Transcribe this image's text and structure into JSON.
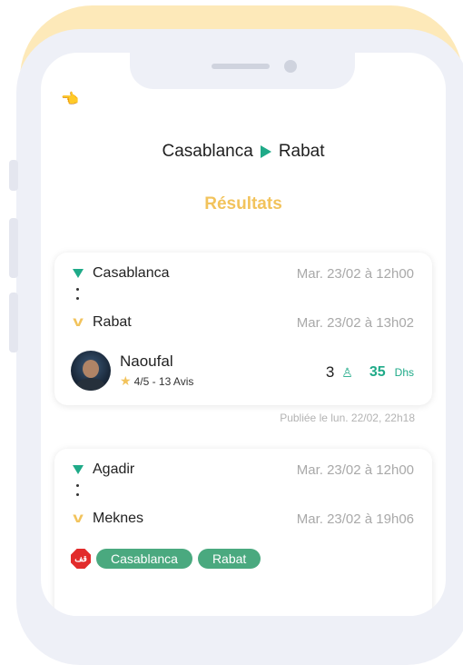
{
  "header": {
    "back_icon": "👈",
    "from": "Casablanca",
    "to": "Rabat",
    "title": "Résultats"
  },
  "results": [
    {
      "from_city": "Casablanca",
      "from_time": "Mar. 23/02 à 12h00",
      "to_city": "Rabat",
      "to_time": "Mar. 23/02 à 13h02",
      "driver_name": "Naoufal",
      "rating": "4/5 - 13 Avis",
      "seats": "3",
      "price": "35",
      "currency": "Dhs",
      "published": "Publiée le lun. 22/02, 22h18"
    },
    {
      "from_city": "Agadir",
      "from_time": "Mar. 23/02 à 12h00",
      "to_city": "Meknes",
      "to_time": "Mar. 23/02 à 19h06",
      "stop_icon_text": "قف",
      "stops": [
        "Casablanca",
        "Rabat"
      ]
    }
  ],
  "colors": {
    "accent": "#1faa88",
    "title": "#f2c35c",
    "chip": "#4aa97f",
    "stop": "#e22b2b"
  }
}
